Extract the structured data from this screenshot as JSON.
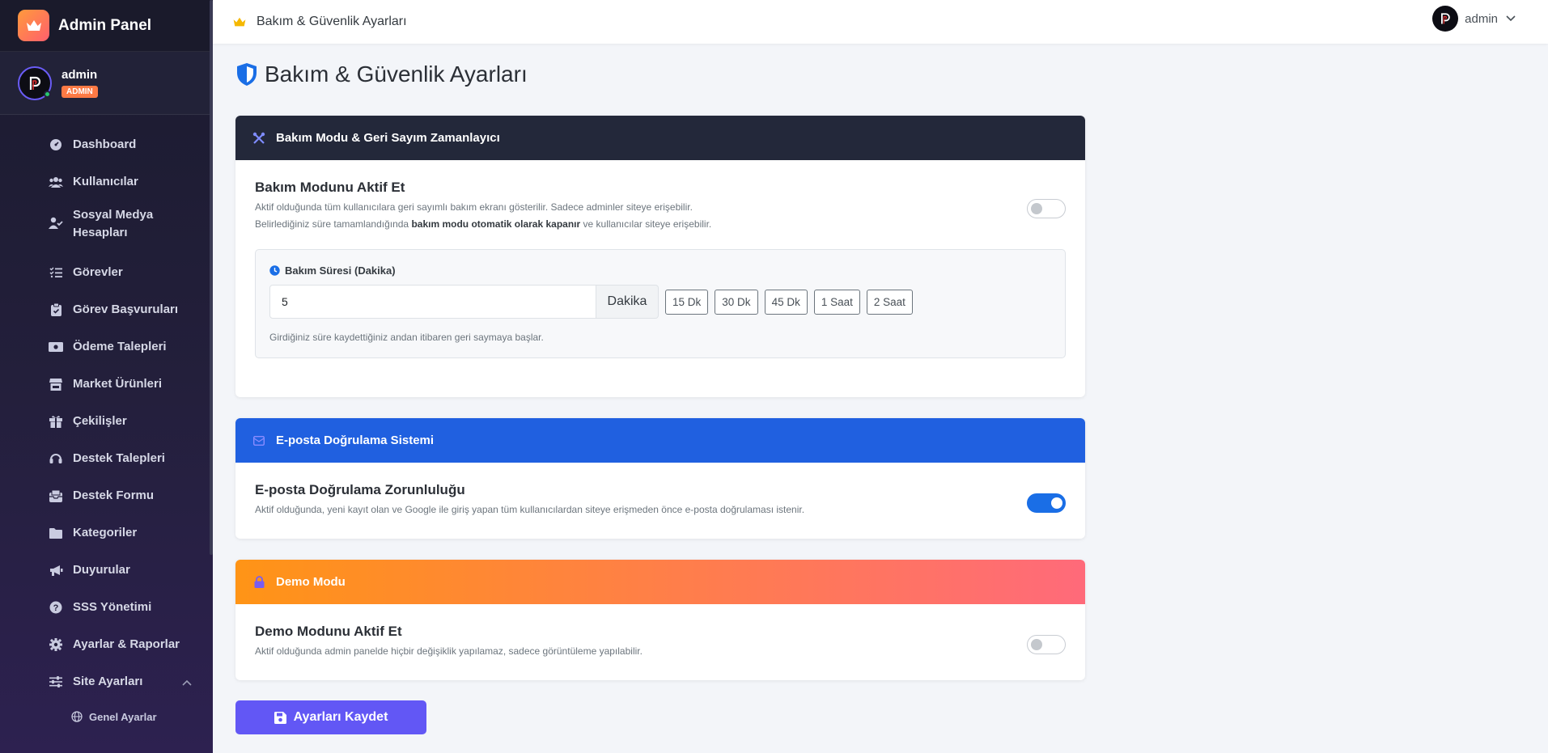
{
  "sidebar": {
    "brand": "Admin Panel",
    "user": {
      "name": "admin",
      "role": "ADMIN"
    },
    "items": [
      {
        "label": "Dashboard",
        "icon": "dashboard-icon"
      },
      {
        "label": "Kullanıcılar",
        "icon": "users-icon"
      },
      {
        "label": "Sosyal Medya Hesapları",
        "icon": "user-check-icon"
      },
      {
        "label": "Görevler",
        "icon": "tasks-icon"
      },
      {
        "label": "Görev Başvuruları",
        "icon": "clipboard-icon"
      },
      {
        "label": "Ödeme Talepleri",
        "icon": "money-icon"
      },
      {
        "label": "Market Ürünleri",
        "icon": "store-icon"
      },
      {
        "label": "Çekilişler",
        "icon": "gift-icon"
      },
      {
        "label": "Destek Talepleri",
        "icon": "headset-icon"
      },
      {
        "label": "Destek Formu",
        "icon": "inbox-icon"
      },
      {
        "label": "Kategoriler",
        "icon": "folder-icon"
      },
      {
        "label": "Duyurular",
        "icon": "megaphone-icon"
      },
      {
        "label": "SSS Yönetimi",
        "icon": "question-icon"
      },
      {
        "label": "Ayarlar & Raporlar",
        "icon": "gear-icon"
      },
      {
        "label": "Site Ayarları",
        "icon": "sliders-icon"
      }
    ],
    "sub_items": [
      {
        "label": "Genel Ayarlar",
        "icon": "globe-icon"
      }
    ]
  },
  "topbar": {
    "title": "Bakım & Güvenlik Ayarları",
    "user": "admin"
  },
  "page": {
    "title": "Bakım & Güvenlik Ayarları"
  },
  "maintenance": {
    "header": "Bakım Modu & Geri Sayım Zamanlayıcı",
    "title": "Bakım Modunu Aktif Et",
    "desc1": "Aktif olduğunda tüm kullanıcılara geri sayımlı bakım ekranı gösterilir. Sadece adminler siteye erişebilir.",
    "desc2_pre": "Belirlediğiniz süre tamamlandığında ",
    "desc2_bold": "bakım modu otomatik olarak kapanır",
    "desc2_post": " ve kullanıcılar siteye erişebilir.",
    "enabled": false,
    "duration_label": "Bakım Süresi (Dakika)",
    "duration_value": "5",
    "duration_unit": "Dakika",
    "presets": [
      "15 Dk",
      "30 Dk",
      "45 Dk",
      "1 Saat",
      "2 Saat"
    ],
    "duration_help": "Girdiğiniz süre kaydettiğiniz andan itibaren geri saymaya başlar."
  },
  "email_verification": {
    "header": "E-posta Doğrulama Sistemi",
    "title": "E-posta Doğrulama Zorunluluğu",
    "desc": "Aktif olduğunda, yeni kayıt olan ve Google ile giriş yapan tüm kullanıcılardan siteye erişmeden önce e-posta doğrulaması istenir.",
    "enabled": true
  },
  "demo": {
    "header": "Demo Modu",
    "title": "Demo Modunu Aktif Et",
    "desc": "Aktif olduğunda admin panelde hiçbir değişiklik yapılamaz, sadece görüntüleme yapılabilir.",
    "enabled": false
  },
  "save_label": "Ayarları Kaydet",
  "colors": {
    "primary": "#6257f5",
    "toggle_on": "#1a6ee6",
    "header_dark": "#23283a",
    "header_blue": "#2060e0"
  }
}
